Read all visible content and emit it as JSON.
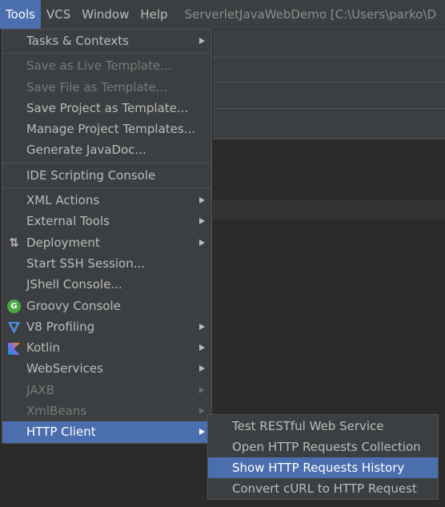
{
  "menubar": {
    "items": [
      {
        "label": "Tools",
        "active": true
      },
      {
        "label": "VCS",
        "active": false
      },
      {
        "label": "Window",
        "active": false
      },
      {
        "label": "Help",
        "active": false
      }
    ],
    "window_title": "ServerletJavaWebDemo [C:\\Users\\parko\\D"
  },
  "tools_menu": {
    "items": [
      {
        "label": "Tasks & Contexts",
        "submenu": true,
        "disabled": false
      },
      {
        "label": "Save as Live Template...",
        "disabled": true
      },
      {
        "label": "Save File as Template...",
        "disabled": true
      },
      {
        "label": "Save Project as Template...",
        "disabled": false
      },
      {
        "label": "Manage Project Templates...",
        "disabled": false
      },
      {
        "label": "Generate JavaDoc...",
        "disabled": false
      },
      {
        "label": "IDE Scripting Console",
        "disabled": false
      },
      {
        "label": "XML Actions",
        "submenu": true
      },
      {
        "label": "External Tools",
        "submenu": true
      },
      {
        "label": "Deployment",
        "submenu": true,
        "icon": "deployment-icon"
      },
      {
        "label": "Start SSH Session...",
        "disabled": false
      },
      {
        "label": "JShell Console...",
        "disabled": false
      },
      {
        "label": "Groovy Console",
        "icon": "groovy-icon",
        "icon_text": "G"
      },
      {
        "label": "V8 Profiling",
        "submenu": true,
        "icon": "v8-icon"
      },
      {
        "label": "Kotlin",
        "submenu": true,
        "icon": "kotlin-icon"
      },
      {
        "label": "WebServices",
        "submenu": true
      },
      {
        "label": "JAXB",
        "submenu": true,
        "disabled": true
      },
      {
        "label": "XmlBeans",
        "submenu": true,
        "disabled": true
      },
      {
        "label": "HTTP Client",
        "submenu": true,
        "selected": true
      }
    ]
  },
  "http_client_submenu": {
    "items": [
      {
        "label": "Test RESTful Web Service"
      },
      {
        "label": "Open HTTP Requests Collection"
      },
      {
        "label": "Show HTTP Requests History",
        "selected": true
      },
      {
        "label": "Convert cURL to HTTP Request"
      }
    ]
  },
  "colors": {
    "selection": "#4b6eaf",
    "menu_bg": "#3c3f41",
    "editor_bg": "#2b2b2b",
    "text": "#bbbbbb",
    "disabled_text": "#787878"
  }
}
